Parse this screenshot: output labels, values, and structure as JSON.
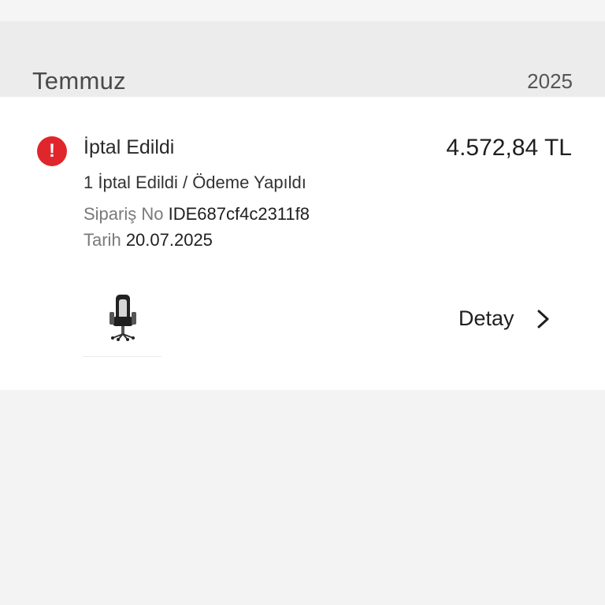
{
  "group": {
    "month": "Temmuz",
    "year": "2025"
  },
  "order": {
    "status": "İptal Edildi",
    "status_icon": "alert-icon",
    "status_color": "#e0262c",
    "price": "4.572,84 TL",
    "summary": "1 İptal Edildi / Ödeme Yapıldı",
    "order_no_label": "Sipariş No",
    "order_no_value": "IDE687cf4c2311f8",
    "date_label": "Tarih",
    "date_value": "20.07.2025",
    "product_icon": "gaming-chair",
    "detail_label": "Detay",
    "detail_icon": "chevron-right-icon"
  }
}
